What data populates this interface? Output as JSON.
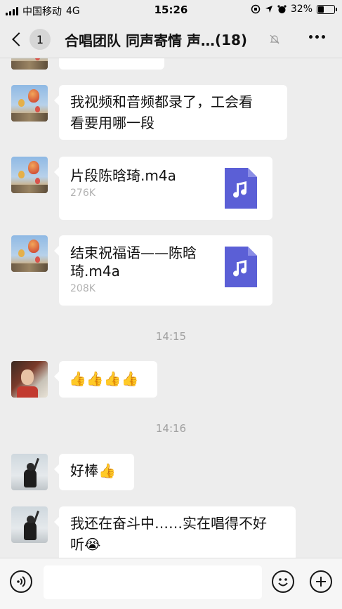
{
  "status_bar": {
    "carrier": "中国移动",
    "network": "4G",
    "time": "15:26",
    "battery": "32%",
    "battery_level": 0.32
  },
  "header": {
    "unread_count": "1",
    "title": "合唱团队 同声寄情 声…",
    "member_count": "(18)"
  },
  "messages": {
    "m0": {
      "type": "text"
    },
    "m1": {
      "type": "text",
      "text_line1": "我视频和音频都录了，工会看",
      "text_line2": "看要用哪一段"
    },
    "m2": {
      "type": "file",
      "file_name": "片段陈晗琦.m4a",
      "file_size": "276K"
    },
    "m3": {
      "type": "file",
      "file_name_line1": "结束祝福语——陈晗",
      "file_name_line2": "琦.m4a",
      "file_size": "208K"
    },
    "t1": "14:15",
    "m4": {
      "type": "emoji",
      "text": "👍👍👍👍"
    },
    "t2": "14:16",
    "m5": {
      "type": "text",
      "text": "好棒👍"
    },
    "m6": {
      "type": "text",
      "text_line1": "我还在奋斗中……实在唱得不好",
      "text_line2": "听😭"
    }
  },
  "input_bar": {
    "placeholder": ""
  },
  "icons": {
    "back": "chevron-left-icon",
    "mute": "bell-slash-icon",
    "more": "more-dots-icon",
    "voice": "voice-icon",
    "emoji": "emoji-icon",
    "plus": "plus-icon",
    "file": "audio-file-icon"
  },
  "colors": {
    "background": "#ededed",
    "bubble": "#ffffff",
    "file_icon": "#5b5fd6"
  }
}
